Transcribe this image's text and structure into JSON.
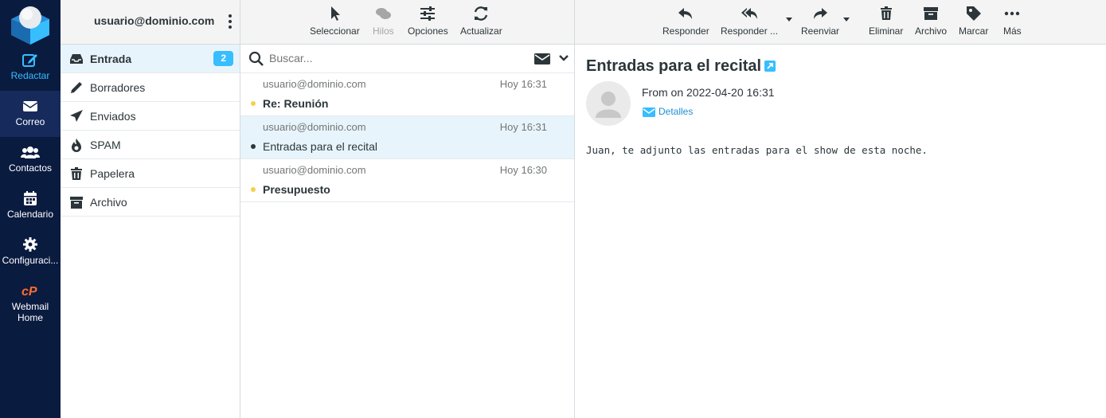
{
  "nav": {
    "compose": "Redactar",
    "mail": "Correo",
    "contacts": "Contactos",
    "calendar": "Calendario",
    "settings": "Configuraci...",
    "webmail_home_1": "Webmail",
    "webmail_home_2": "Home"
  },
  "folders": {
    "account": "usuario@dominio.com",
    "items": [
      {
        "label": "Entrada",
        "badge": "2",
        "icon": "inbox-icon"
      },
      {
        "label": "Borradores",
        "icon": "pencil-icon"
      },
      {
        "label": "Enviados",
        "icon": "paper-plane-icon"
      },
      {
        "label": "SPAM",
        "icon": "fire-icon"
      },
      {
        "label": "Papelera",
        "icon": "trash-icon"
      },
      {
        "label": "Archivo",
        "icon": "archive-box-icon"
      }
    ]
  },
  "list_toolbar": {
    "select": "Seleccionar",
    "threads": "Hilos",
    "options": "Opciones",
    "refresh": "Actualizar"
  },
  "search": {
    "placeholder": "Buscar..."
  },
  "messages": [
    {
      "from": "usuario@dominio.com",
      "date": "Hoy 16:31",
      "subject": "Re: Reunión",
      "unread": true,
      "dot_color": "#f5d04a"
    },
    {
      "from": "usuario@dominio.com",
      "date": "Hoy 16:31",
      "subject": "Entradas para el recital",
      "unread": false,
      "selected": true,
      "dot_color": "#2c363a"
    },
    {
      "from": "usuario@dominio.com",
      "date": "Hoy 16:30",
      "subject": "Presupuesto",
      "unread": true,
      "dot_color": "#f5d04a"
    }
  ],
  "preview_toolbar": {
    "reply": "Responder",
    "reply_all": "Responder ...",
    "forward": "Reenviar",
    "delete": "Eliminar",
    "archive": "Archivo",
    "mark": "Marcar",
    "more": "Más"
  },
  "preview": {
    "subject": "Entradas para el recital",
    "header_line": "From on 2022-04-20 16:31",
    "details": "Detalles",
    "body": "Juan, te adjunto las entradas para el show de esta noche."
  },
  "colors": {
    "nav_bg": "#0a1b40",
    "accent": "#37beff",
    "link": "#1f8fd4",
    "selected_bg": "#e8f4fb"
  }
}
